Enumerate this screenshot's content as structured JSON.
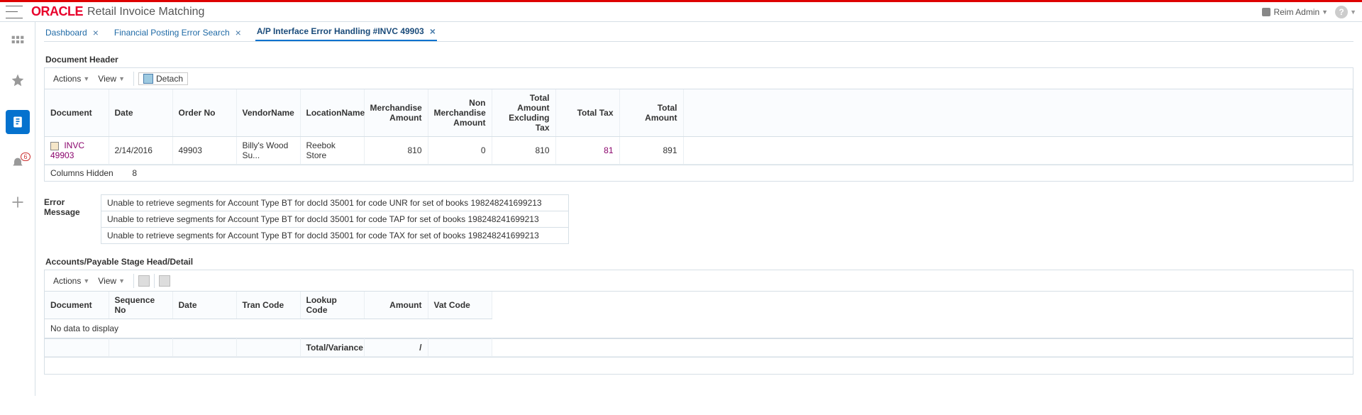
{
  "header": {
    "logo": "ORACLE",
    "app_title": "Retail Invoice Matching",
    "user_name": "Reim Admin"
  },
  "tabs": [
    {
      "label": "Dashboard",
      "closable": true,
      "active": false
    },
    {
      "label": "Financial Posting Error Search",
      "closable": true,
      "active": false
    },
    {
      "label": "A/P Interface Error Handling #INVC 49903",
      "closable": true,
      "active": true
    }
  ],
  "document_header": {
    "title": "Document Header",
    "toolbar": {
      "actions": "Actions",
      "view": "View",
      "detach": "Detach"
    },
    "columns": {
      "document": "Document",
      "date": "Date",
      "order_no": "Order No",
      "vendor_name": "VendorName",
      "location_name": "LocationName",
      "merchandise_amount": "Merchandise Amount",
      "non_merchandise_amount": "Non Merchandise Amount",
      "total_amount_excl_tax": "Total Amount Excluding Tax",
      "total_tax": "Total Tax",
      "total_amount": "Total Amount"
    },
    "row": {
      "document": "INVC 49903",
      "date": "2/14/2016",
      "order_no": "49903",
      "vendor_name": "Billy's Wood Su...",
      "location_name": "Reebok Store",
      "merchandise_amount": "810",
      "non_merchandise_amount": "0",
      "total_amount_excl_tax": "810",
      "total_tax": "81",
      "total_amount": "891"
    },
    "footer": {
      "label": "Columns Hidden",
      "value": "8"
    }
  },
  "errors": {
    "label": "Error Message",
    "messages": [
      "Unable to retrieve segments for Account Type BT for docId 35001 for code UNR for set of books 198248241699213",
      "Unable to retrieve segments for Account Type BT for docId 35001 for code TAP for set of books 198248241699213",
      "Unable to retrieve segments for Account Type BT for docId 35001 for code TAX for set of books 198248241699213"
    ]
  },
  "stage": {
    "title": "Accounts/Payable Stage Head/Detail",
    "toolbar": {
      "actions": "Actions",
      "view": "View"
    },
    "columns": {
      "document": "Document",
      "sequence_no": "Sequence No",
      "date": "Date",
      "tran_code": "Tran Code",
      "lookup_code": "Lookup Code",
      "amount": "Amount",
      "vat_code": "Vat Code"
    },
    "no_data": "No data to display",
    "total_row": {
      "label": "Total/Variance",
      "amount": "/"
    }
  },
  "sideRail": {
    "notification_count": "6"
  }
}
